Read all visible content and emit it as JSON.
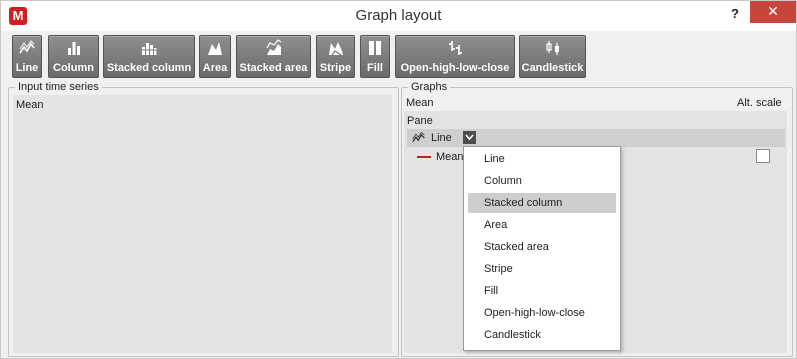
{
  "window": {
    "title": "Graph layout",
    "app_icon_letter": "M",
    "help_label": "?",
    "close_label": "✕"
  },
  "toolbar": {
    "buttons": [
      {
        "label": "Line",
        "icon": "line-chart-icon"
      },
      {
        "label": "Column",
        "icon": "column-chart-icon"
      },
      {
        "label": "Stacked column",
        "icon": "stacked-column-chart-icon"
      },
      {
        "label": "Area",
        "icon": "area-chart-icon"
      },
      {
        "label": "Stacked area",
        "icon": "stacked-area-chart-icon"
      },
      {
        "label": "Stripe",
        "icon": "stripe-chart-icon"
      },
      {
        "label": "Fill",
        "icon": "fill-chart-icon"
      },
      {
        "label": "Open-high-low-close",
        "icon": "ohlc-chart-icon"
      },
      {
        "label": "Candlestick",
        "icon": "candlestick-chart-icon"
      }
    ]
  },
  "input_panel": {
    "legend": "Input time series",
    "items": [
      "Mean"
    ]
  },
  "graphs_panel": {
    "legend": "Graphs",
    "header_series": "Mean",
    "header_alt_scale": "Alt. scale",
    "pane_label": "Pane",
    "graph_type": "Line",
    "series_label": "Mean",
    "series_color": "#c81e1e",
    "alt_scale_checked": false
  },
  "dropdown": {
    "options": [
      "Line",
      "Column",
      "Stacked column",
      "Area",
      "Stacked area",
      "Stripe",
      "Fill",
      "Open-high-low-close",
      "Candlestick"
    ],
    "highlighted": "Stacked column"
  }
}
